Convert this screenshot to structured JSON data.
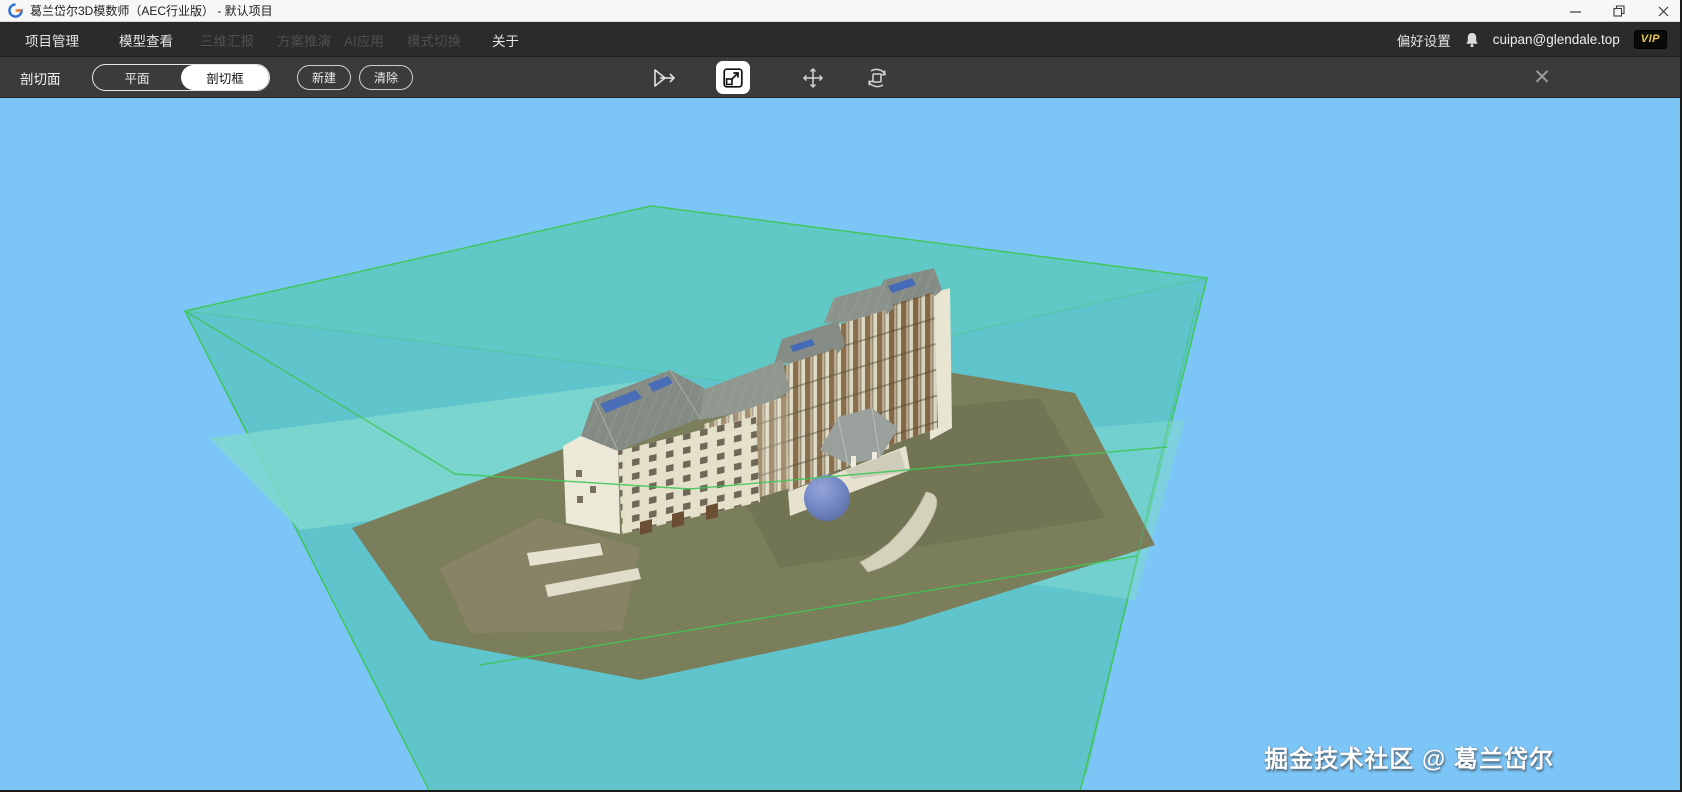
{
  "window": {
    "title": "葛兰岱尔3D模数师（AEC行业版） - 默认项目",
    "controls": {
      "minimize": "─",
      "restore": "❐",
      "close": "✕"
    }
  },
  "menu": {
    "items": [
      {
        "label": "项目管理",
        "enabled": true
      },
      {
        "label": "模型查看",
        "enabled": true
      },
      {
        "label": "三维汇报",
        "enabled": false
      },
      {
        "label": "方案推演",
        "enabled": false
      },
      {
        "label": "AI应用",
        "enabled": false
      },
      {
        "label": "模式切换",
        "enabled": false
      },
      {
        "label": "关于",
        "enabled": true
      }
    ],
    "preferences": "偏好设置",
    "account": "cuipan@glendale.top",
    "vip": "VIP"
  },
  "toolbar": {
    "panel_label": "剖切面",
    "mode_plane": "平面",
    "mode_box": "剖切框",
    "selected_mode": "剖切框",
    "new_button": "新建",
    "clear_button": "清除",
    "icons": [
      "section-export-icon",
      "scale-icon",
      "move-icon",
      "rotate-icon"
    ],
    "selected_icon": "scale-icon",
    "close": "✕"
  },
  "viewport": {
    "watermark": "掘金技术社区 @ 葛兰岱尔",
    "colors": {
      "sky": "#7cc5f7",
      "section_box_fill": "#3ec39a",
      "section_box_edge": "#3fc657",
      "ground": "#7b7e5a",
      "road": "#7fd8ce",
      "building_wall": "#e4e0ca",
      "building_roof": "#858c85",
      "window_band": "#7a5c38",
      "sphere": "#7286c2"
    }
  }
}
